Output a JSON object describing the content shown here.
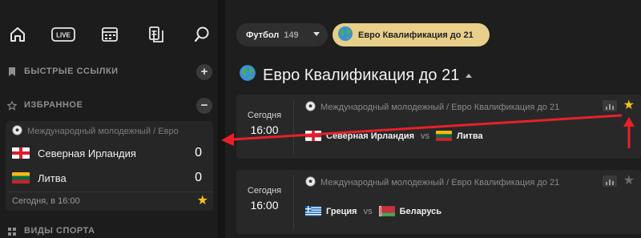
{
  "sidebar": {
    "nav_icons": [
      "home-icon",
      "live-icon",
      "calendar-icon",
      "coupon-icon",
      "search-icon"
    ],
    "live_label": "LIVE",
    "quick_links": {
      "label": "БЫСТРЫЕ ССЫЛКИ",
      "button": "+"
    },
    "favorites": {
      "label": "ИЗБРАННОЕ",
      "button": "−",
      "card": {
        "league": "Международный молодежный / Евро",
        "teams": [
          {
            "name": "Северная Ирландия",
            "score": "0",
            "flag": "northern-ireland"
          },
          {
            "name": "Литва",
            "score": "0",
            "flag": "lithuania"
          }
        ],
        "time": "Сегодня, в 16:00",
        "star": "★"
      }
    },
    "sports": {
      "label": "ВИДЫ СПОРТА"
    }
  },
  "main": {
    "sport_chip": {
      "label": "Футбол",
      "count": "149"
    },
    "league_chip": {
      "label": "Евро Квалификация до 21"
    },
    "title": "Евро Квалификация до 21",
    "matches": [
      {
        "date": "Сегодня",
        "time": "16:00",
        "league": "Международный молодежный / Евро Квалификация до 21",
        "home": "Северная Ирландия",
        "away": "Литва",
        "vs": "vs",
        "favorite": true,
        "star": "★"
      },
      {
        "date": "Сегодня",
        "time": "16:00",
        "league": "Международный молодежный / Евро Квалификация до 21",
        "home": "Греция",
        "away": "Беларусь",
        "vs": "vs",
        "favorite": false,
        "star": "★"
      }
    ]
  },
  "colors": {
    "accent_star": "#f2c318",
    "league_chip_bg": "#e8cf8a",
    "annotation_arrow": "#e8202a"
  }
}
